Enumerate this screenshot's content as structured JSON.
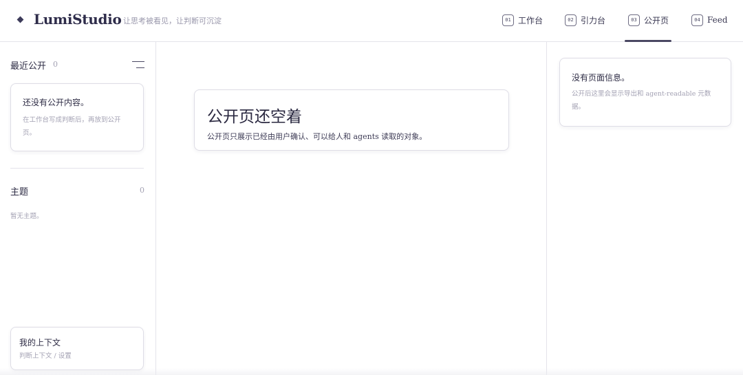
{
  "brand": {
    "name": "LumiStudio",
    "tagline": "让思考被看见，让判断可沉淀"
  },
  "nav": [
    {
      "num": "01",
      "label": "工作台"
    },
    {
      "num": "02",
      "label": "引力台"
    },
    {
      "num": "03",
      "label": "公开页",
      "active": true
    },
    {
      "num": "04",
      "label": "Feed"
    }
  ],
  "sidebar": {
    "recent": {
      "title": "最近公开",
      "count": "0",
      "empty_title": "还没有公开内容。",
      "empty_desc": "在工作台写成判断后，再放到公开页。"
    },
    "topics": {
      "title": "主题",
      "count": "0",
      "empty": "暂无主题。"
    },
    "context": {
      "title": "我的上下文",
      "sub": "判断上下文 / 设置"
    }
  },
  "main": {
    "title": "公开页还空着",
    "desc": "公开页只展示已经由用户确认、可以给人和 agents 读取的对象。"
  },
  "right_panel": {
    "title": "没有页面信息。",
    "desc": "公开后这里会显示导出和 agent-readable 元数据。"
  },
  "colors": {
    "accent": "#4a4863",
    "border": "#e4e3ea",
    "muted_text": "#a3a1b3"
  }
}
